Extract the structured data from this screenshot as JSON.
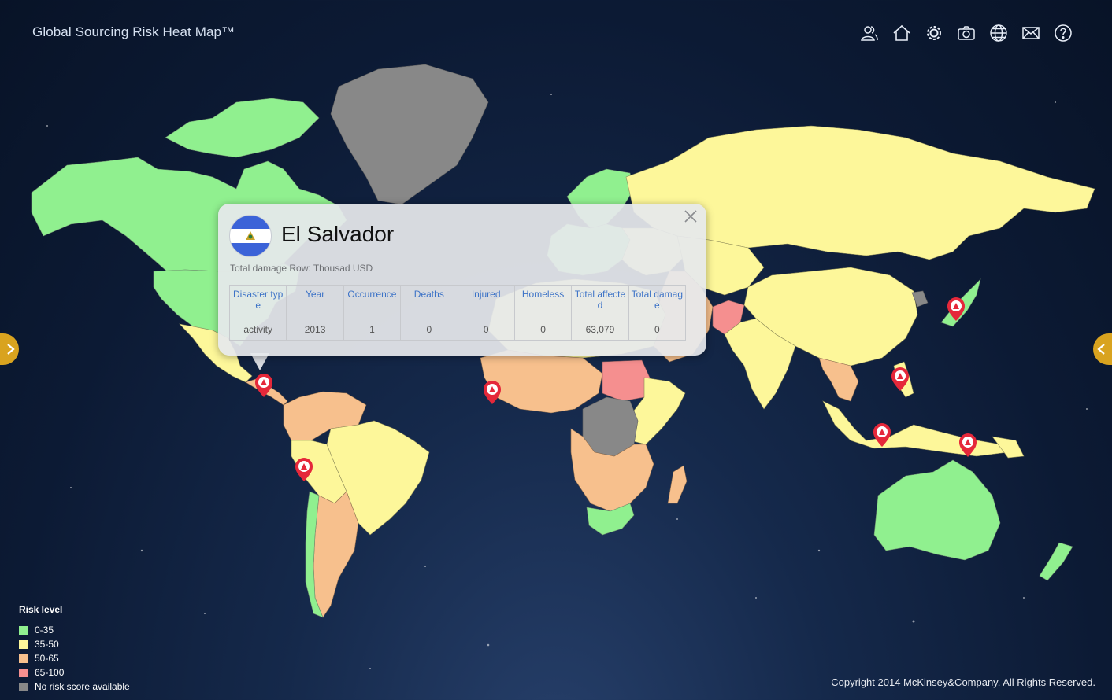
{
  "app": {
    "title": "Global Sourcing Risk Heat Map™"
  },
  "toolbar": {
    "icons": [
      "users-icon",
      "home-icon",
      "settings-gear-icon",
      "camera-icon",
      "globe-icon",
      "mail-icon",
      "help-icon"
    ]
  },
  "popup": {
    "country": "El Salvador",
    "note": "Total damage Row: Thousad USD",
    "columns": [
      "Disaster type",
      "Year",
      "Occurrence",
      "Deaths",
      "Injured",
      "Homeless",
      "Total affected",
      "Total damage"
    ],
    "row": [
      "activity",
      "2013",
      "1",
      "0",
      "0",
      "0",
      "63,079",
      "0"
    ]
  },
  "legend": {
    "title": "Risk level",
    "items": [
      {
        "label": "0-35",
        "color": "#90f08f"
      },
      {
        "label": "35-50",
        "color": "#fdf79a"
      },
      {
        "label": "50-65",
        "color": "#f7c08d"
      },
      {
        "label": "65-100",
        "color": "#f58f8f"
      },
      {
        "label": "No risk score available",
        "color": "#888888"
      }
    ]
  },
  "colors": {
    "low": "#90f08f",
    "medium": "#fdf79a",
    "elevated": "#f7c08d",
    "high": "#f58f8f",
    "none": "#888888",
    "marker": "#e5283a",
    "arrow": "#d9a31f"
  },
  "markers": [
    "disaster-marker-el-salvador",
    "disaster-marker-peru",
    "disaster-marker-sierra-leone",
    "disaster-marker-japan",
    "disaster-marker-philippines",
    "disaster-marker-indonesia-java",
    "disaster-marker-indonesia-east"
  ],
  "copyright": "Copyright 2014 McKinsey&Company. All Rights Reserved."
}
